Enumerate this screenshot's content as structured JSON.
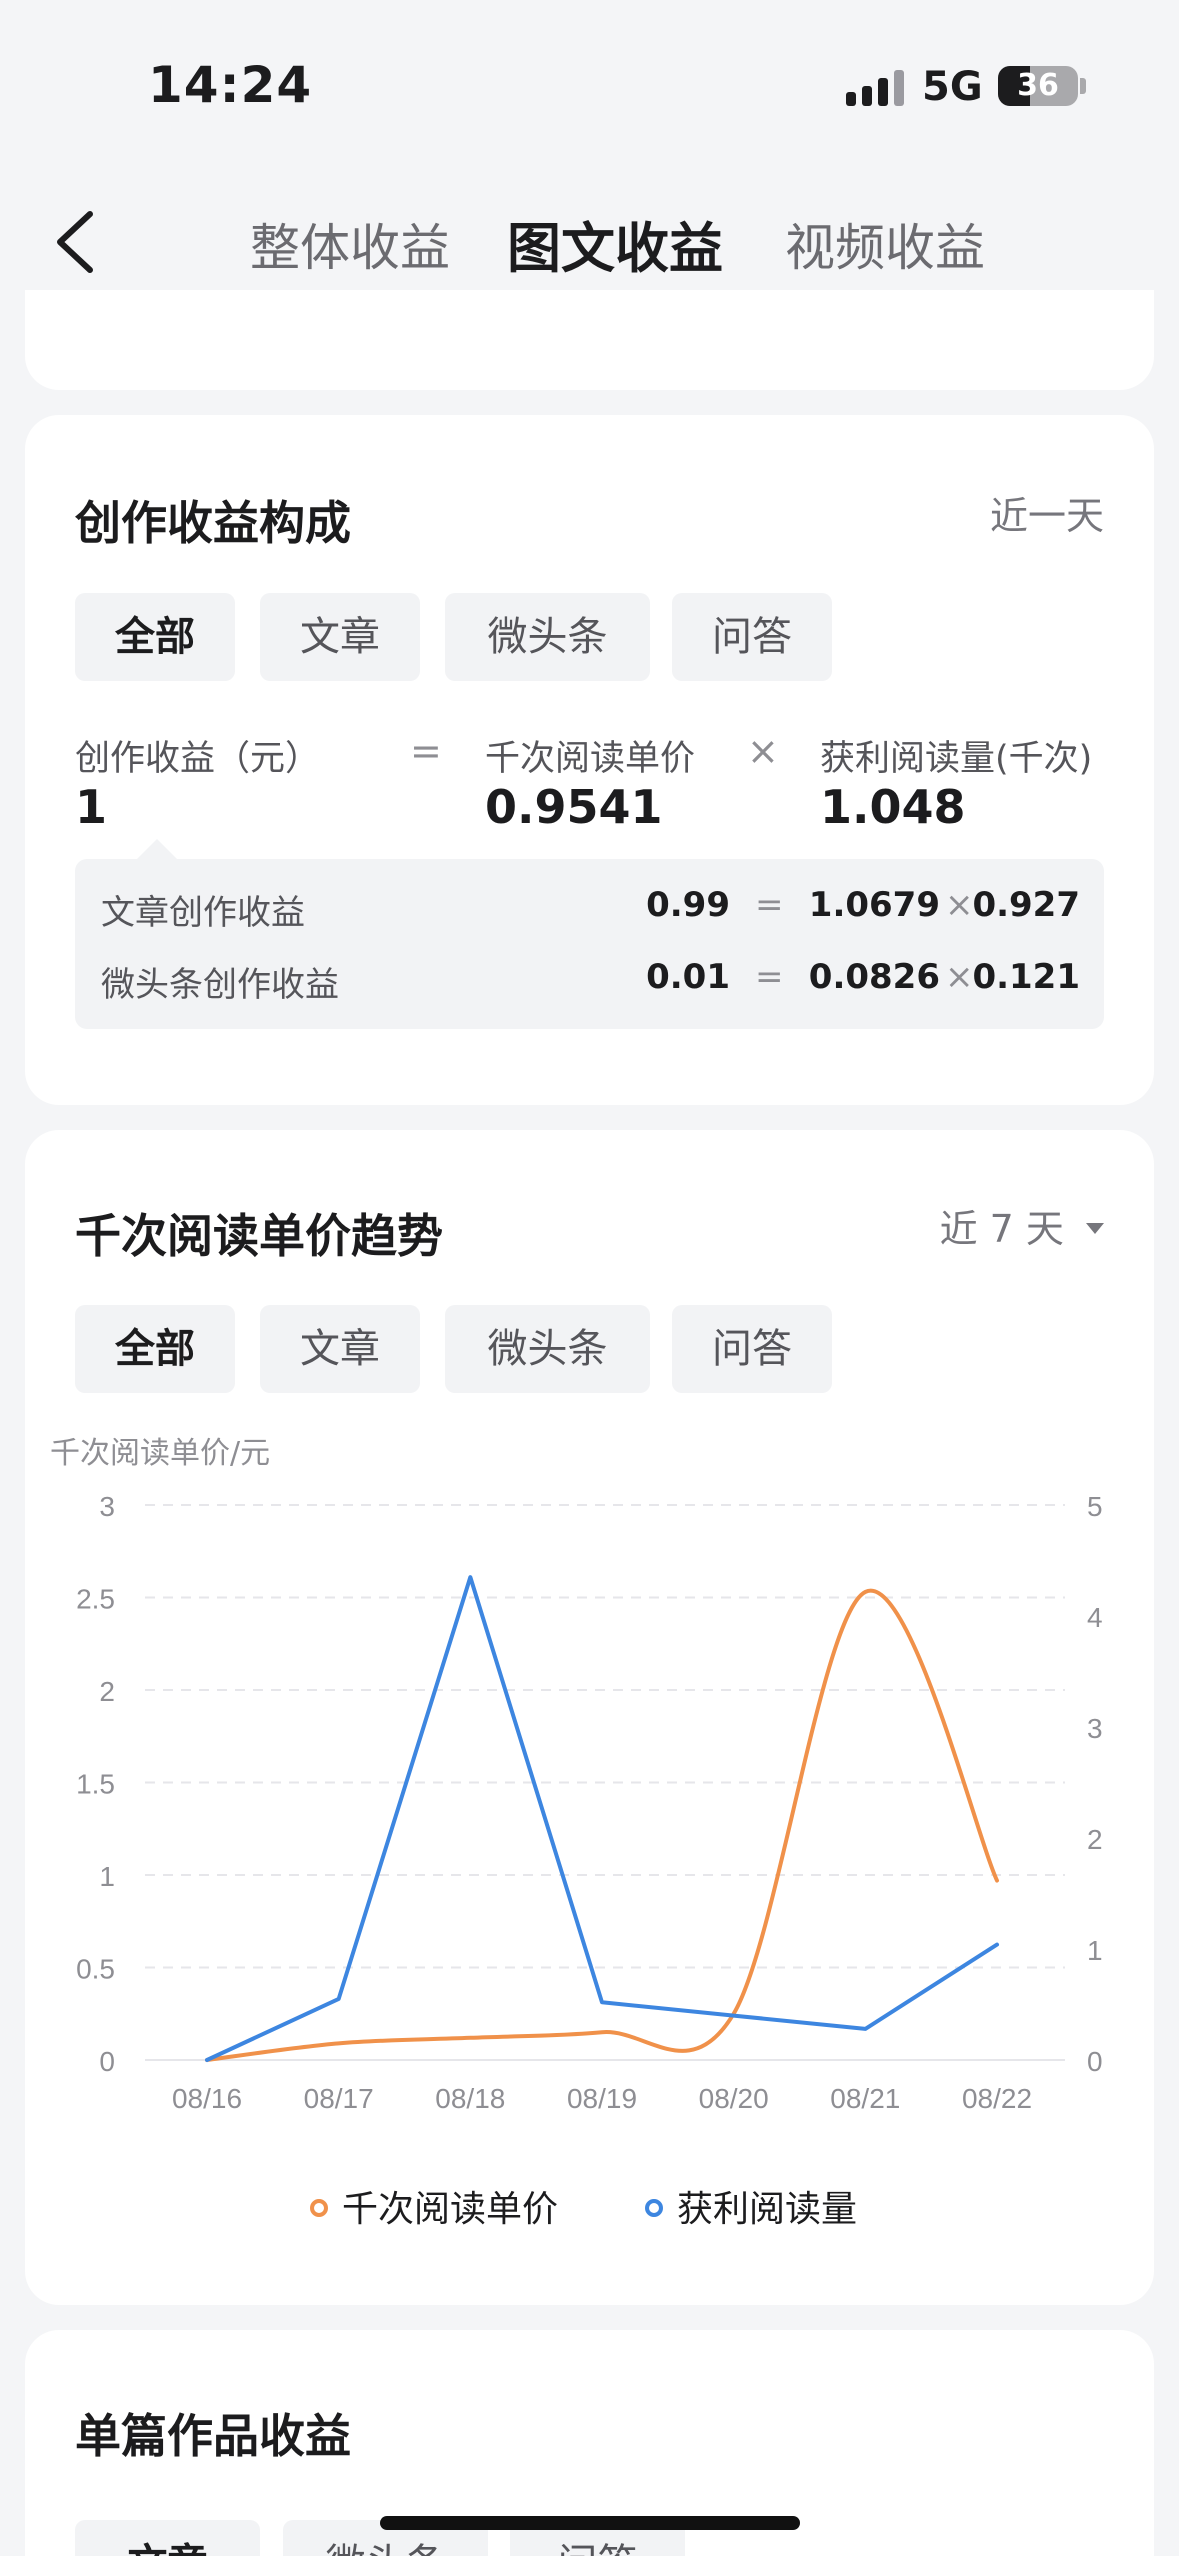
{
  "status": {
    "time": "14:24",
    "network": "5G",
    "battery": "36"
  },
  "nav": {
    "tabs": [
      "整体收益",
      "图文收益",
      "视频收益"
    ],
    "active": "图文收益"
  },
  "composition": {
    "title": "创作收益构成",
    "range": "近一天",
    "filters": [
      "全部",
      "文章",
      "微头条",
      "问答"
    ],
    "formula": {
      "revenue_label": "创作收益（元）",
      "revenue_value": "1",
      "eq": "=",
      "price_label": "千次阅读单价",
      "price_value": "0.9541",
      "times": "×",
      "reads_label": "获利阅读量(千次)",
      "reads_value": "1.048"
    },
    "details": [
      {
        "label": "文章创作收益",
        "revenue": "0.99",
        "eq": "=",
        "price": "1.0679",
        "times": "×",
        "reads": "0.927"
      },
      {
        "label": "微头条创作收益",
        "revenue": "0.01",
        "eq": "=",
        "price": "0.0826",
        "times": "×",
        "reads": "0.121"
      }
    ]
  },
  "trend": {
    "title": "千次阅读单价趋势",
    "range": "近 7 天",
    "filters": [
      "全部",
      "文章",
      "微头条",
      "问答"
    ],
    "axis_title": "千次阅读单价/元"
  },
  "chart_data": {
    "type": "line",
    "x": [
      "08/16",
      "08/17",
      "08/18",
      "08/19",
      "08/20",
      "08/21",
      "08/22"
    ],
    "series": [
      {
        "name": "千次阅读单价",
        "axis": "left",
        "color": "#f0914a",
        "values": [
          0.0,
          0.09,
          0.12,
          0.15,
          0.25,
          2.53,
          0.97
        ]
      },
      {
        "name": "获利阅读量",
        "axis": "right",
        "color": "#3d86e0",
        "values": [
          0.0,
          0.55,
          4.35,
          0.52,
          0.4,
          0.28,
          1.04
        ]
      }
    ],
    "y_left": {
      "ticks": [
        "0",
        "0.5",
        "1",
        "1.5",
        "2",
        "2.5",
        "3"
      ],
      "range": [
        0,
        3
      ]
    },
    "y_right": {
      "ticks": [
        "0",
        "1",
        "2",
        "3",
        "4",
        "5"
      ],
      "range": [
        0,
        5
      ]
    },
    "grid": true,
    "legend": "bottom"
  },
  "single": {
    "title": "单篇作品收益",
    "filters": [
      "文章",
      "微头条",
      "问答"
    ]
  }
}
